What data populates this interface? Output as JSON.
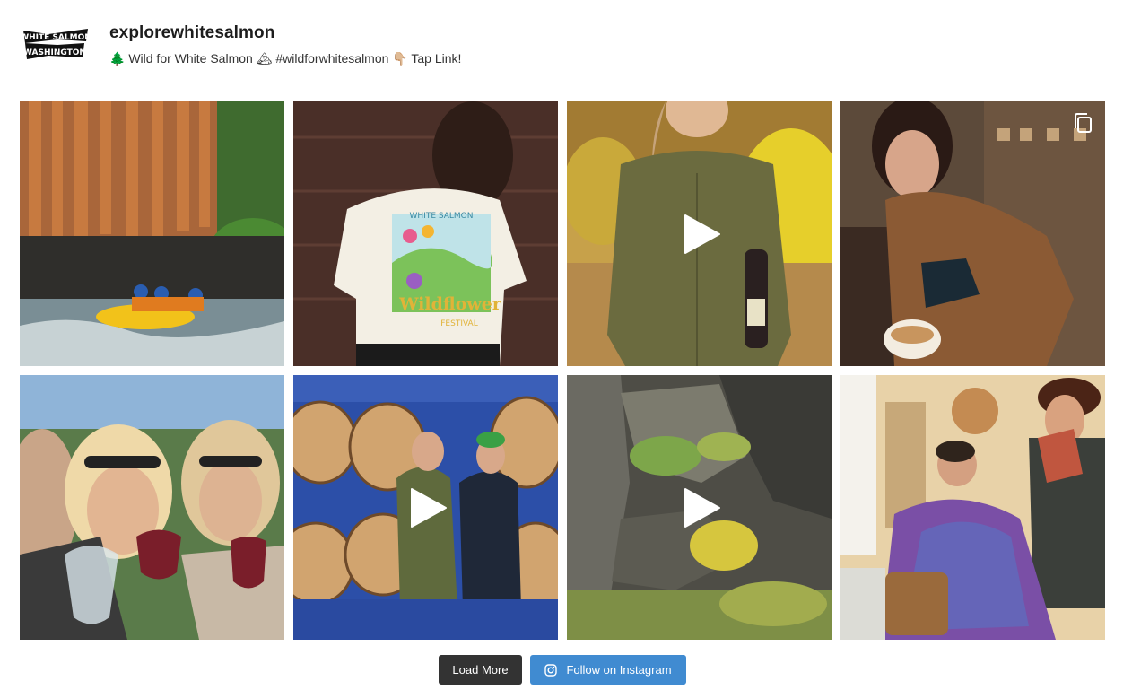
{
  "colors": {
    "load_more_bg": "#333333",
    "follow_bg": "#408bd1",
    "text_dark": "#1d1d1d"
  },
  "header": {
    "logo_icon": "white-salmon-washington-logo",
    "logo_text_line1": "WHITE SALMON",
    "logo_text_line2": "WASHINGTON",
    "username": "explorewhitesalmon",
    "bio": "🌲 Wild for White Salmon 🏔 #wildforwhitesalmon 👇🏼 Tap Link!"
  },
  "posts": [
    {
      "type": "image",
      "subject": "river rafting below basalt cliffs",
      "icon": ""
    },
    {
      "type": "image",
      "subject": "White Salmon Wildflower Fest t-shirt",
      "icon": "",
      "shirt_text_top": "WHITE SALMON",
      "shirt_text_bottom": "Wildflower",
      "shirt_text_small": "FESTIVAL"
    },
    {
      "type": "video",
      "subject": "woman holding wine bottle in vineyard",
      "icon": "play-icon"
    },
    {
      "type": "carousel",
      "subject": "barista pouring latte art",
      "icon": "carousel-icon"
    },
    {
      "type": "image",
      "subject": "friends toasting with wine glasses",
      "icon": ""
    },
    {
      "type": "video",
      "subject": "winemakers among barrels",
      "icon": "play-icon"
    },
    {
      "type": "video",
      "subject": "wildflowers on basalt rock face",
      "icon": "play-icon"
    },
    {
      "type": "image",
      "subject": "barber cutting hair in salon",
      "icon": ""
    }
  ],
  "footer": {
    "load_more_label": "Load More",
    "follow_label": "Follow on Instagram",
    "follow_icon": "instagram-icon"
  }
}
